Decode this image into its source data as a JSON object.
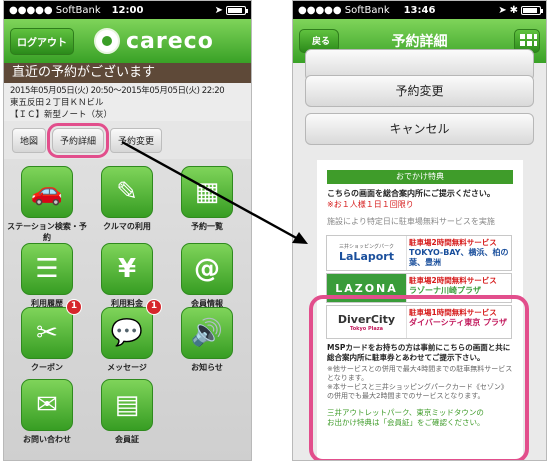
{
  "left": {
    "status": {
      "carrier": "●●●●● SoftBank",
      "time": "12:00"
    },
    "logout_label": "ログアウト",
    "logo_text": "careco",
    "banner": "直近の予約がございます",
    "reservation": {
      "line1": "2015年05月05日(火) 20:50〜2015年05月05日(火) 22:20",
      "line2": "東五反田２丁目ＫＮビル",
      "line3": "【ＩＣ】新型ノート（灰）"
    },
    "tabs": [
      "地図",
      "予約詳細",
      "予約変更"
    ],
    "menu": [
      {
        "label": "ステーション検索・予約",
        "icon": "car-icon"
      },
      {
        "label": "クルマの利用",
        "icon": "key-icon"
      },
      {
        "label": "予約一覧",
        "icon": "calendar-icon"
      },
      {
        "label": "利用履歴",
        "icon": "history-icon"
      },
      {
        "label": "利用料金",
        "icon": "yen-icon"
      },
      {
        "label": "会員情報",
        "icon": "member-icon"
      },
      {
        "label": "クーポン",
        "icon": "coupon-icon",
        "badge": "1"
      },
      {
        "label": "メッセージ",
        "icon": "message-icon",
        "badge": "1"
      },
      {
        "label": "お知らせ",
        "icon": "speaker-icon"
      },
      {
        "label": "お問い合わせ",
        "icon": "mail-icon"
      },
      {
        "label": "会員証",
        "icon": "card-icon"
      }
    ]
  },
  "right": {
    "status": {
      "carrier": "●●●●● SoftBank",
      "time": "13:46"
    },
    "back_label": "戻る",
    "title": "予約詳細",
    "buttons": [
      "予約変更",
      "キャンセル"
    ],
    "card": {
      "header": "おでかけ特典",
      "lead": "こちらの画面を総合案内所にご提示ください。",
      "limit": "※お１人様１日１回限り",
      "note": "施設により特定日に駐車場無料サービスを実施"
    },
    "ads": [
      {
        "logo": "LaLaport",
        "logo_sub": "三井ショッピングパーク",
        "offer": "駐車場2時間無料サービス",
        "name": "TOKYO-BAY、横浜、柏の葉、豊洲"
      },
      {
        "logo": "LAZONA",
        "logo_sub": "",
        "offer": "駐車場2時間無料サービス",
        "name": "ラゾーナ川崎プラザ"
      },
      {
        "logo": "DiverCity",
        "logo_sub": "Tokyo Plaza",
        "offer": "駐車場1時間無料サービス",
        "name": "ダイバーシティ東京 プラザ"
      }
    ],
    "footer": {
      "main": "MSPカードをお持ちの方は事前にこちらの画面と共に総合案内所に駐車券とあわせてご提示下さい。",
      "n1": "※他サービスとの併用で最大4時間までの駐車無料サービスとなります。",
      "n2": "※本サービスと三井ショッピングパークカード《セゾン》の併用でも最大2時間までのサービスとなります。",
      "tail1": "三井アウトレットパーク、東京ミッドタウンの",
      "tail2": "お出かけ特典は「会員証」をご確認ください。"
    }
  }
}
